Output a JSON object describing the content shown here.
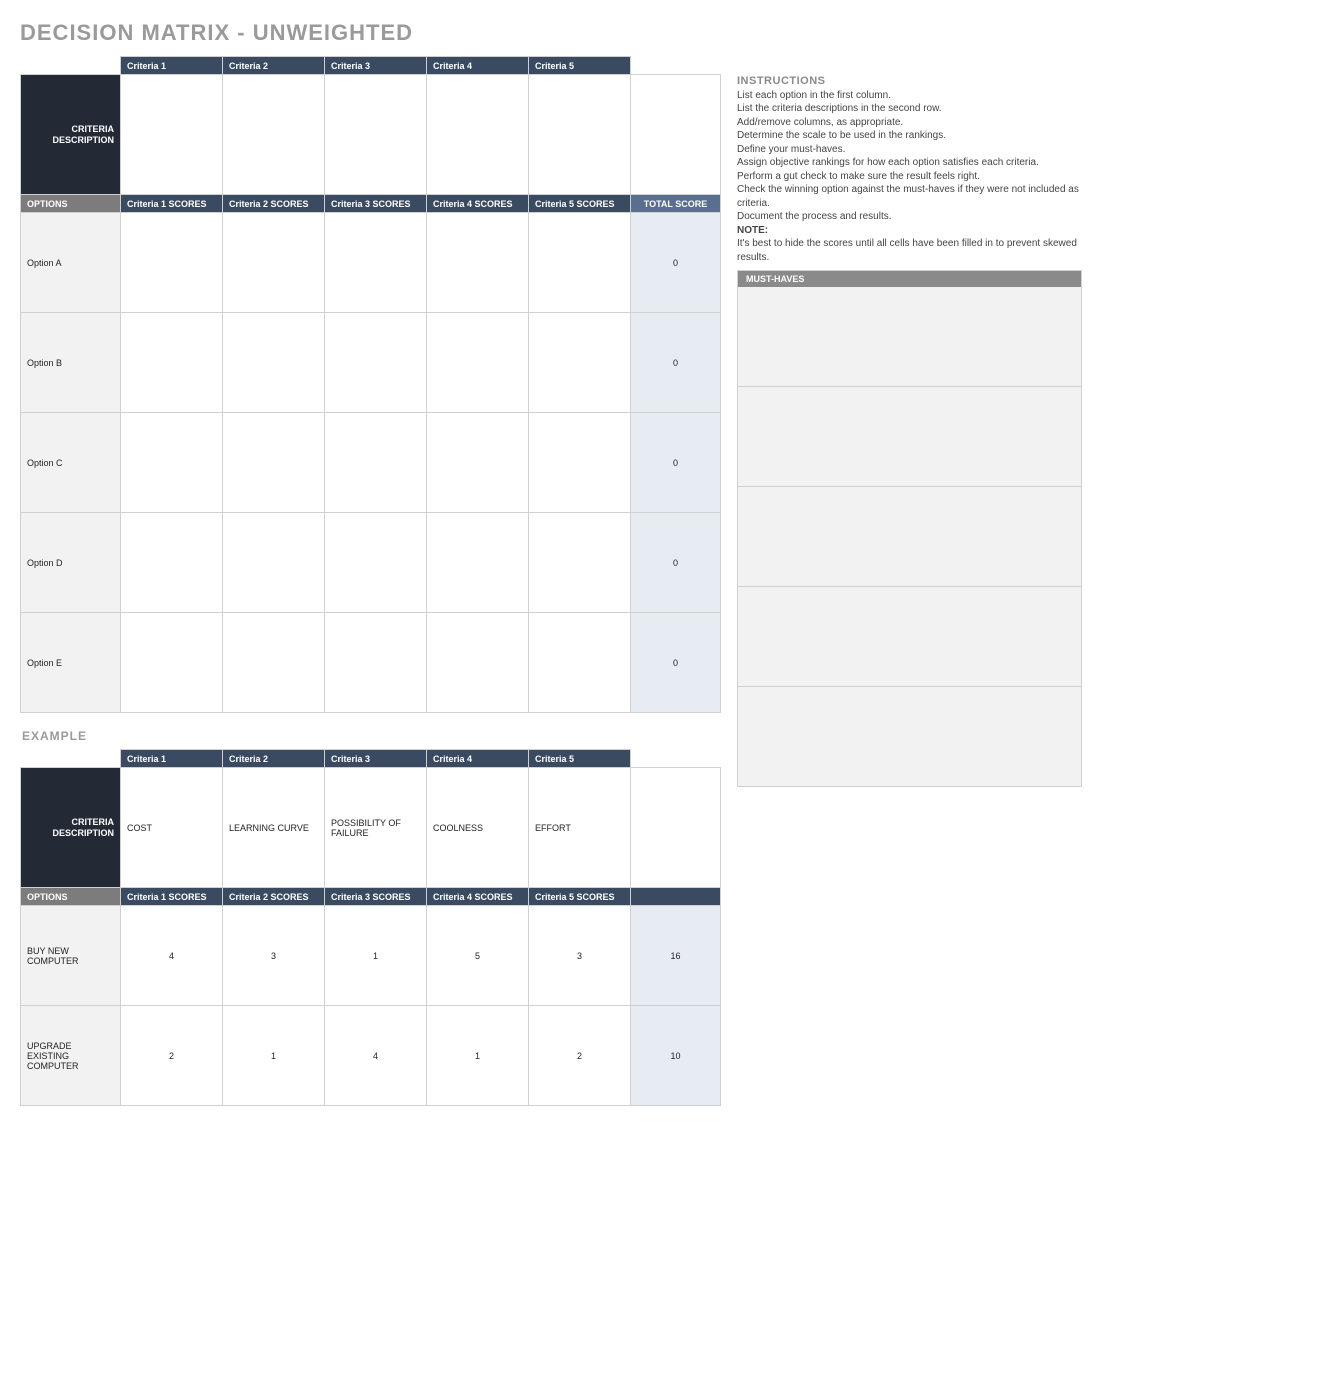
{
  "title": "DECISION MATRIX - UNWEIGHTED",
  "main": {
    "criteria_headers": [
      "Criteria 1",
      "Criteria 2",
      "Criteria 3",
      "Criteria 4",
      "Criteria 5"
    ],
    "criteria_desc_label": "CRITERIA DESCRIPTION",
    "criteria_desc": [
      "",
      "",
      "",
      "",
      ""
    ],
    "options_label": "OPTIONS",
    "score_headers": [
      "Criteria 1 SCORES",
      "Criteria 2 SCORES",
      "Criteria 3 SCORES",
      "Criteria 4 SCORES",
      "Criteria 5 SCORES"
    ],
    "total_label": "TOTAL SCORE",
    "rows": [
      {
        "option": "Option A",
        "scores": [
          "",
          "",
          "",
          "",
          ""
        ],
        "total": "0"
      },
      {
        "option": "Option B",
        "scores": [
          "",
          "",
          "",
          "",
          ""
        ],
        "total": "0"
      },
      {
        "option": "Option C",
        "scores": [
          "",
          "",
          "",
          "",
          ""
        ],
        "total": "0"
      },
      {
        "option": "Option D",
        "scores": [
          "",
          "",
          "",
          "",
          ""
        ],
        "total": "0"
      },
      {
        "option": "Option E",
        "scores": [
          "",
          "",
          "",
          "",
          ""
        ],
        "total": "0"
      }
    ]
  },
  "instructions": {
    "heading": "INSTRUCTIONS",
    "lines": [
      "List each option in the first column.",
      "List the criteria descriptions in the second row.",
      "Add/remove columns, as appropriate.",
      "Determine the scale to be used in the rankings.",
      "Define your must-haves.",
      "Assign objective rankings for how each option satisfies each criteria.",
      "Perform a gut check to make sure the result feels right.",
      "Check the winning option against the must-haves if they were not included as criteria.",
      "Document the process and results."
    ],
    "note_label": "NOTE:",
    "note": "It's best to hide the scores until all cells have been filled in to prevent skewed results."
  },
  "musthaves": {
    "heading": "MUST-HAVES",
    "rows": [
      "",
      "",
      "",
      "",
      ""
    ]
  },
  "example": {
    "heading": "EXAMPLE",
    "criteria_headers": [
      "Criteria 1",
      "Criteria 2",
      "Criteria 3",
      "Criteria 4",
      "Criteria 5"
    ],
    "criteria_desc_label": "CRITERIA DESCRIPTION",
    "criteria_desc": [
      "COST",
      "LEARNING CURVE",
      "POSSIBILITY OF FAILURE",
      "COOLNESS",
      "EFFORT"
    ],
    "options_label": "OPTIONS",
    "score_headers": [
      "Criteria 1 SCORES",
      "Criteria 2 SCORES",
      "Criteria 3 SCORES",
      "Criteria 4 SCORES",
      "Criteria 5 SCORES"
    ],
    "total_label": "",
    "rows": [
      {
        "option": "BUY NEW COMPUTER",
        "scores": [
          "4",
          "3",
          "1",
          "5",
          "3"
        ],
        "total": "16"
      },
      {
        "option": "UPGRADE EXISTING COMPUTER",
        "scores": [
          "2",
          "1",
          "4",
          "1",
          "2"
        ],
        "total": "10"
      }
    ]
  }
}
